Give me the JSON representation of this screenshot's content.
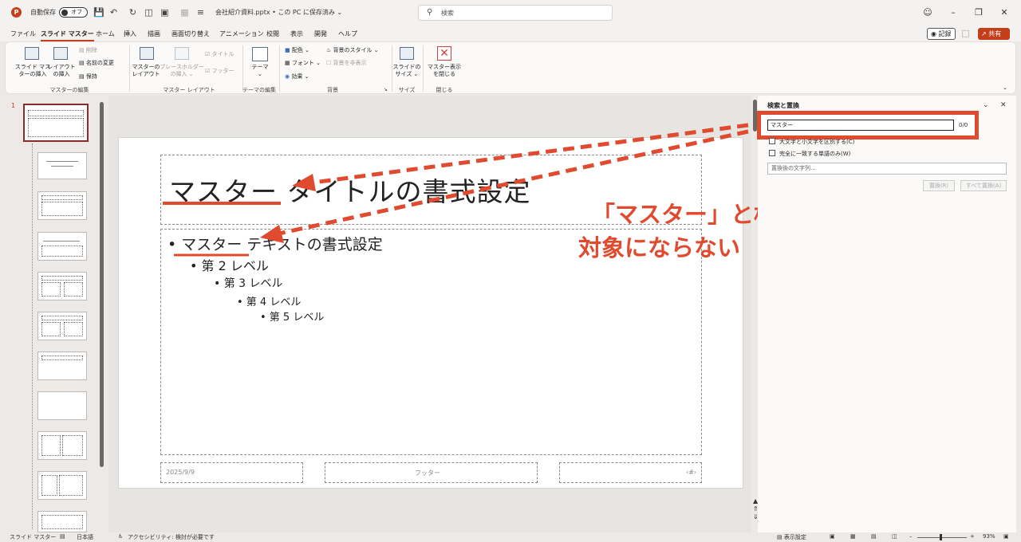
{
  "titlebar": {
    "autosave_label": "自動保存",
    "autosave_state": "オフ",
    "filename": "会社紹介資料.pptx • この PC に保存済み ⌄",
    "search_placeholder": "検索",
    "icons": [
      "powerpoint-icon",
      "save-icon",
      "undo-icon",
      "redo-icon",
      "present-icon",
      "layout-icon",
      "customize-icon",
      "user-icon",
      "minimize-icon",
      "restore-icon",
      "close-icon"
    ]
  },
  "menu": {
    "tabs": [
      "ファイル",
      "スライド マスター",
      "ホーム",
      "挿入",
      "描画",
      "画面切り替え",
      "アニメーション",
      "校閲",
      "表示",
      "開発",
      "ヘルプ"
    ],
    "active_tab": "スライド マスター",
    "record_label": "記録",
    "share_label": "共有"
  },
  "ribbon": {
    "insert_master": "スライド マス\nターの挿入",
    "insert_layout": "レイアウト\nの挿入",
    "delete": "削除",
    "rename": "名前の変更",
    "preserve": "保持",
    "group_edit_master": "マスターの編集",
    "master_layout": "マスターの\nレイアウト",
    "insert_placeholder": "プレースホルダー\nの挿入 ⌄",
    "title_chk": "タイトル",
    "footer_chk": "フッター",
    "group_master_layout": "マスター レイアウト",
    "themes": "テーマ\n⌄",
    "group_edit_theme": "テーマの編集",
    "colors": "配色 ⌄",
    "fonts": "フォント ⌄",
    "effects": "効果 ⌄",
    "bg_styles": "背景のスタイル ⌄",
    "hide_bg": "背景を非表示",
    "group_background": "背景",
    "slide_size": "スライドの\nサイズ ⌄",
    "group_size": "サイズ",
    "close_master": "マスター表示\nを閉じる",
    "group_close": "閉じる"
  },
  "thumbnails": {
    "first_number": "1"
  },
  "slide": {
    "title": "マスター タイトルの書式設定",
    "bullets": [
      "• マスター テキストの書式設定",
      "• 第 2 レベル",
      "• 第 3 レベル",
      "• 第 4 レベル",
      "• 第 5 レベル"
    ],
    "date": "2025/9/9",
    "footer": "フッター",
    "page_number": "‹#›"
  },
  "annotation": {
    "line1": "「マスター」と検索しても",
    "line2": "対象にならない",
    "color": "#e04a2e"
  },
  "find_pane": {
    "title": "検索と置換",
    "query": "マスター",
    "count": "0/0",
    "match_case": "大文字と小文字を区別する(C)",
    "whole_word": "完全に一致する単語のみ(W)",
    "replace_placeholder": "置換後の文字列...",
    "replace": "置換(R)",
    "replace_all": "すべて置換(A)"
  },
  "statusbar": {
    "view": "スライド マスター",
    "language": "日本語",
    "accessibility": "アクセシビリティ: 検討が必要です",
    "display_settings": "表示設定",
    "zoom": "93%"
  }
}
